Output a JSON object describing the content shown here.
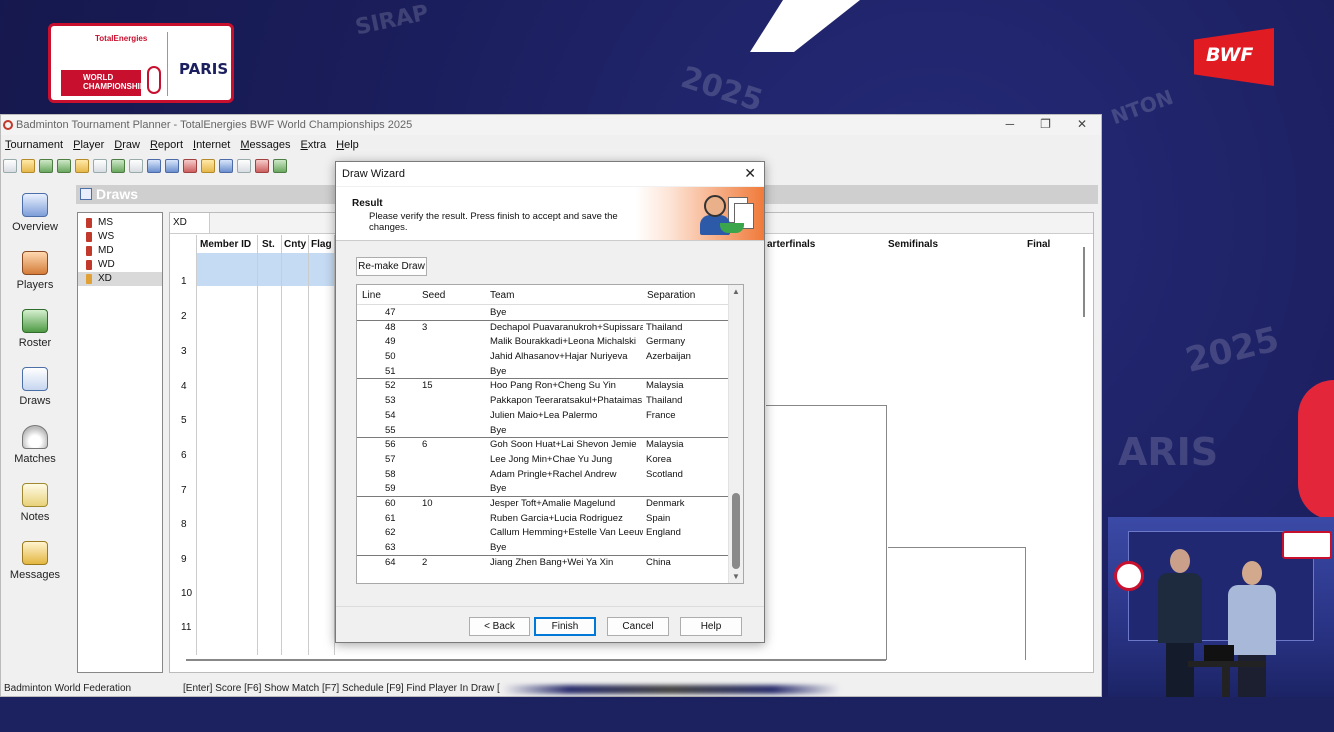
{
  "broadcast": {
    "sponsor": "TotalEnergies",
    "event_lines": [
      "WORLD",
      "CHAMPIONSHIPS"
    ],
    "city": "PARIS",
    "federation_logo": "BWF",
    "colors": {
      "navy": "#1b1f5e",
      "red": "#e11b22",
      "accent_red": "#c8102e"
    }
  },
  "window": {
    "title": "Badminton Tournament Planner - TotalEnergies BWF World Championships 2025",
    "controls": [
      "─",
      "❐",
      "✕"
    ]
  },
  "menu": [
    "Tournament",
    "Player",
    "Draw",
    "Report",
    "Internet",
    "Messages",
    "Extra",
    "Help"
  ],
  "sidebar": {
    "items": [
      {
        "label": "Overview",
        "icon": "overview-icon"
      },
      {
        "label": "Players",
        "icon": "players-icon"
      },
      {
        "label": "Roster",
        "icon": "roster-icon"
      },
      {
        "label": "Draws",
        "icon": "draws-icon"
      },
      {
        "label": "Matches",
        "icon": "shuttlecock-icon"
      },
      {
        "label": "Notes",
        "icon": "notes-icon"
      },
      {
        "label": "Messages",
        "icon": "envelope-icon"
      }
    ]
  },
  "draws": {
    "header": "Draws",
    "events": [
      "MS",
      "WS",
      "MD",
      "WD",
      "XD"
    ],
    "selected_event": "XD",
    "active_tab": "XD",
    "columns": [
      "Member ID",
      "St.",
      "Cnty",
      "Flag"
    ],
    "rounds": [
      "arterfinals",
      "Semifinals",
      "Final"
    ],
    "row_numbers": [
      "1",
      "2",
      "3",
      "4",
      "5",
      "6",
      "7",
      "8",
      "9",
      "10",
      "11"
    ]
  },
  "statusbar": {
    "left": "Badminton World Federation",
    "hints": "[Enter] Score [F6] Show Match [F7] Schedule [F9] Find Player In Draw ["
  },
  "dialog": {
    "title": "Draw Wizard",
    "heading": "Result",
    "instructions": "Please verify the result. Press finish to accept and save the changes.",
    "remake_button": "Re-make Draw",
    "columns": {
      "line": "Line",
      "seed": "Seed",
      "team": "Team",
      "separation": "Separation"
    },
    "rows": [
      {
        "line": "47",
        "seed": "",
        "team": "Bye",
        "separation": ""
      },
      {
        "line": "48",
        "seed": "3",
        "team": "Dechapol Puavaranukroh+Supissara",
        "separation": "Thailand"
      },
      {
        "line": "49",
        "seed": "",
        "team": "Malik Bourakkadi+Leona Michalski",
        "separation": "Germany"
      },
      {
        "line": "50",
        "seed": "",
        "team": "Jahid Alhasanov+Hajar Nuriyeva",
        "separation": "Azerbaijan"
      },
      {
        "line": "51",
        "seed": "",
        "team": "Bye",
        "separation": ""
      },
      {
        "line": "52",
        "seed": "15",
        "team": "Hoo Pang Ron+Cheng Su Yin",
        "separation": "Malaysia"
      },
      {
        "line": "53",
        "seed": "",
        "team": "Pakkapon Teeraratsakul+Phataimas I",
        "separation": "Thailand"
      },
      {
        "line": "54",
        "seed": "",
        "team": "Julien Maio+Lea Palermo",
        "separation": "France"
      },
      {
        "line": "55",
        "seed": "",
        "team": "Bye",
        "separation": ""
      },
      {
        "line": "56",
        "seed": "6",
        "team": "Goh Soon Huat+Lai Shevon Jemie",
        "separation": "Malaysia"
      },
      {
        "line": "57",
        "seed": "",
        "team": "Lee Jong Min+Chae Yu Jung",
        "separation": "Korea"
      },
      {
        "line": "58",
        "seed": "",
        "team": "Adam Pringle+Rachel Andrew",
        "separation": "Scotland"
      },
      {
        "line": "59",
        "seed": "",
        "team": "Bye",
        "separation": ""
      },
      {
        "line": "60",
        "seed": "10",
        "team": "Jesper Toft+Amalie Magelund",
        "separation": "Denmark"
      },
      {
        "line": "61",
        "seed": "",
        "team": "Ruben Garcia+Lucia Rodriguez",
        "separation": "Spain"
      },
      {
        "line": "62",
        "seed": "",
        "team": "Callum Hemming+Estelle Van Leeuwe",
        "separation": "England"
      },
      {
        "line": "63",
        "seed": "",
        "team": "Bye",
        "separation": ""
      },
      {
        "line": "64",
        "seed": "2",
        "team": "Jiang Zhen Bang+Wei Ya Xin",
        "separation": "China"
      }
    ],
    "buttons": {
      "back": "< Back",
      "finish": "Finish",
      "cancel": "Cancel",
      "help": "Help"
    },
    "scroll_position": 0.85
  }
}
